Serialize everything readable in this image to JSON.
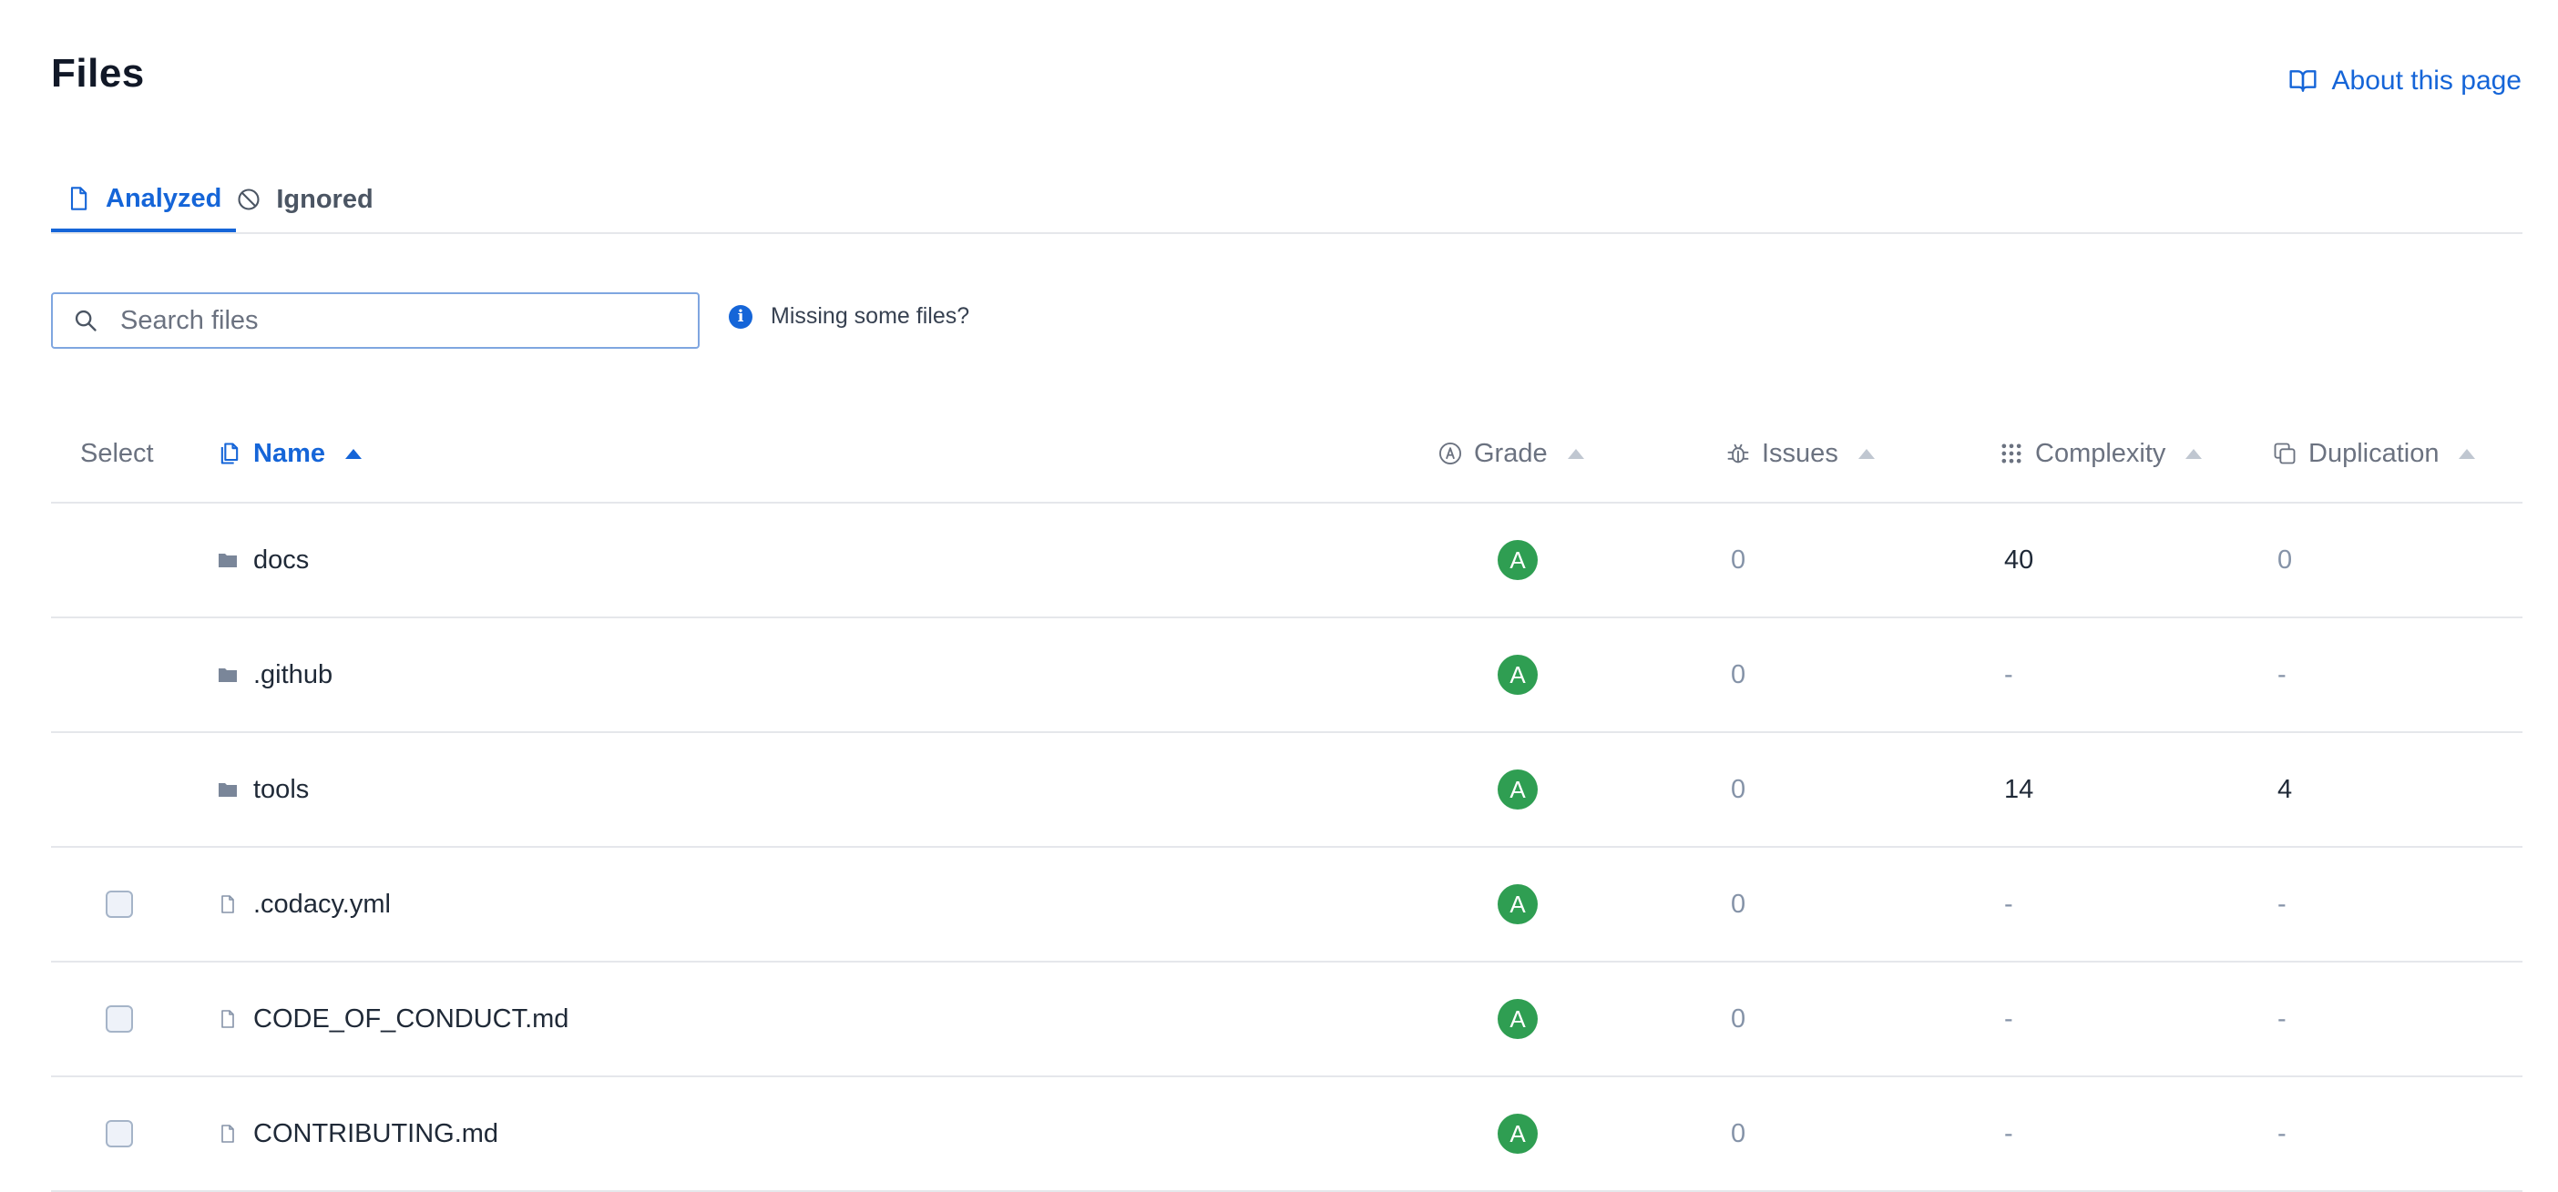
{
  "header": {
    "title": "Files",
    "about_label": "About this page"
  },
  "tabs": [
    {
      "label": "Analyzed",
      "active": true,
      "icon": "file-icon"
    },
    {
      "label": "Ignored",
      "active": false,
      "icon": "ban-icon"
    }
  ],
  "search": {
    "placeholder": "Search files",
    "value": ""
  },
  "missing_files_label": "Missing some files?",
  "columns": {
    "select": "Select",
    "name": "Name",
    "grade": "Grade",
    "issues": "Issues",
    "complexity": "Complexity",
    "duplication": "Duplication"
  },
  "sorted_by": "Name",
  "rows": [
    {
      "type": "folder",
      "name": "docs",
      "grade": "A",
      "issues": "0",
      "complexity": "40",
      "duplication": "0"
    },
    {
      "type": "folder",
      "name": ".github",
      "grade": "A",
      "issues": "0",
      "complexity": "-",
      "duplication": "-"
    },
    {
      "type": "folder",
      "name": "tools",
      "grade": "A",
      "issues": "0",
      "complexity": "14",
      "duplication": "4"
    },
    {
      "type": "file",
      "name": ".codacy.yml",
      "grade": "A",
      "issues": "0",
      "complexity": "-",
      "duplication": "-"
    },
    {
      "type": "file",
      "name": "CODE_OF_CONDUCT.md",
      "grade": "A",
      "issues": "0",
      "complexity": "-",
      "duplication": "-"
    },
    {
      "type": "file",
      "name": "CONTRIBUTING.md",
      "grade": "A",
      "issues": "0",
      "complexity": "-",
      "duplication": "-"
    }
  ],
  "colors": {
    "accent": "#1565d8",
    "grade_a": "#2f9e52",
    "muted_text": "#8593a8"
  }
}
